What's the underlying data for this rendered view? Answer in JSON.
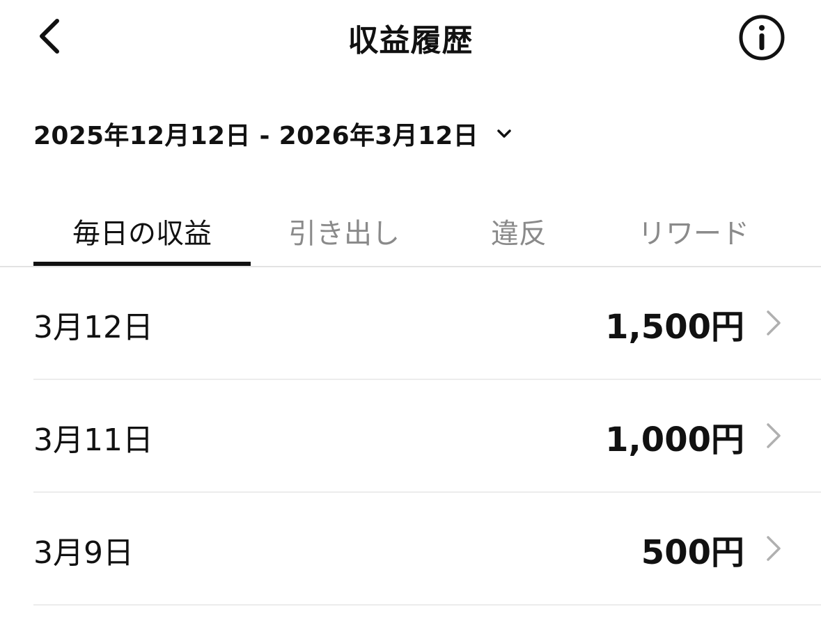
{
  "header": {
    "title": "収益履歴",
    "back_icon": "chevron-left-icon",
    "info_icon": "info-circle-icon"
  },
  "date_range": {
    "label": "2025年12月12日 - 2026年3月12日",
    "icon": "chevron-down-icon"
  },
  "tabs": [
    {
      "label": "毎日の収益",
      "active": true
    },
    {
      "label": "引き出し",
      "active": false
    },
    {
      "label": "違反",
      "active": false
    },
    {
      "label": "リワード",
      "active": false
    }
  ],
  "earnings": [
    {
      "date": "3月12日",
      "amount": "1,500円"
    },
    {
      "date": "3月11日",
      "amount": "1,000円"
    },
    {
      "date": "3月9日",
      "amount": "500円"
    }
  ],
  "colors": {
    "text_primary": "#111111",
    "text_inactive": "#8a8a8a",
    "divider": "#ececec",
    "chevron": "#b0b0b0"
  }
}
